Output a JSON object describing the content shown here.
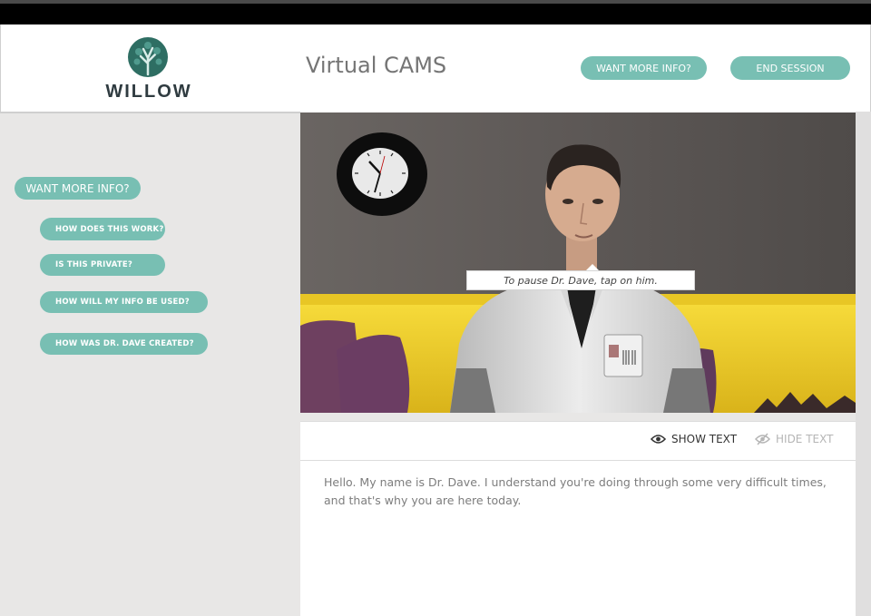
{
  "header": {
    "logo_text": "WILLOW",
    "app_title": "Virtual CAMS",
    "info_button": "WANT MORE INFO?",
    "end_button": "END SESSION"
  },
  "sidebar": {
    "main_button": "WANT MORE INFO?",
    "faq": [
      "HOW DOES THIS WORK?",
      "IS THIS PRIVATE?",
      "HOW  WILL MY INFO BE USED?",
      "HOW WAS DR. DAVE CREATED?"
    ]
  },
  "video": {
    "tooltip": "To pause Dr. Dave, tap on him."
  },
  "text_controls": {
    "show_label": "SHOW TEXT",
    "hide_label": "HIDE TEXT"
  },
  "transcript": {
    "text": "Hello. My name is Dr. Dave. I understand you're doing through some very difficult times, and that's why you are here today."
  },
  "colors": {
    "accent": "#78bfb3",
    "sidebar_bg": "#e8e7e6",
    "wall": "#5f5a57",
    "sofa": "#f3d12c"
  },
  "icons": [
    "tree-logo-icon",
    "clock-icon",
    "eye-icon",
    "eye-slash-icon"
  ]
}
